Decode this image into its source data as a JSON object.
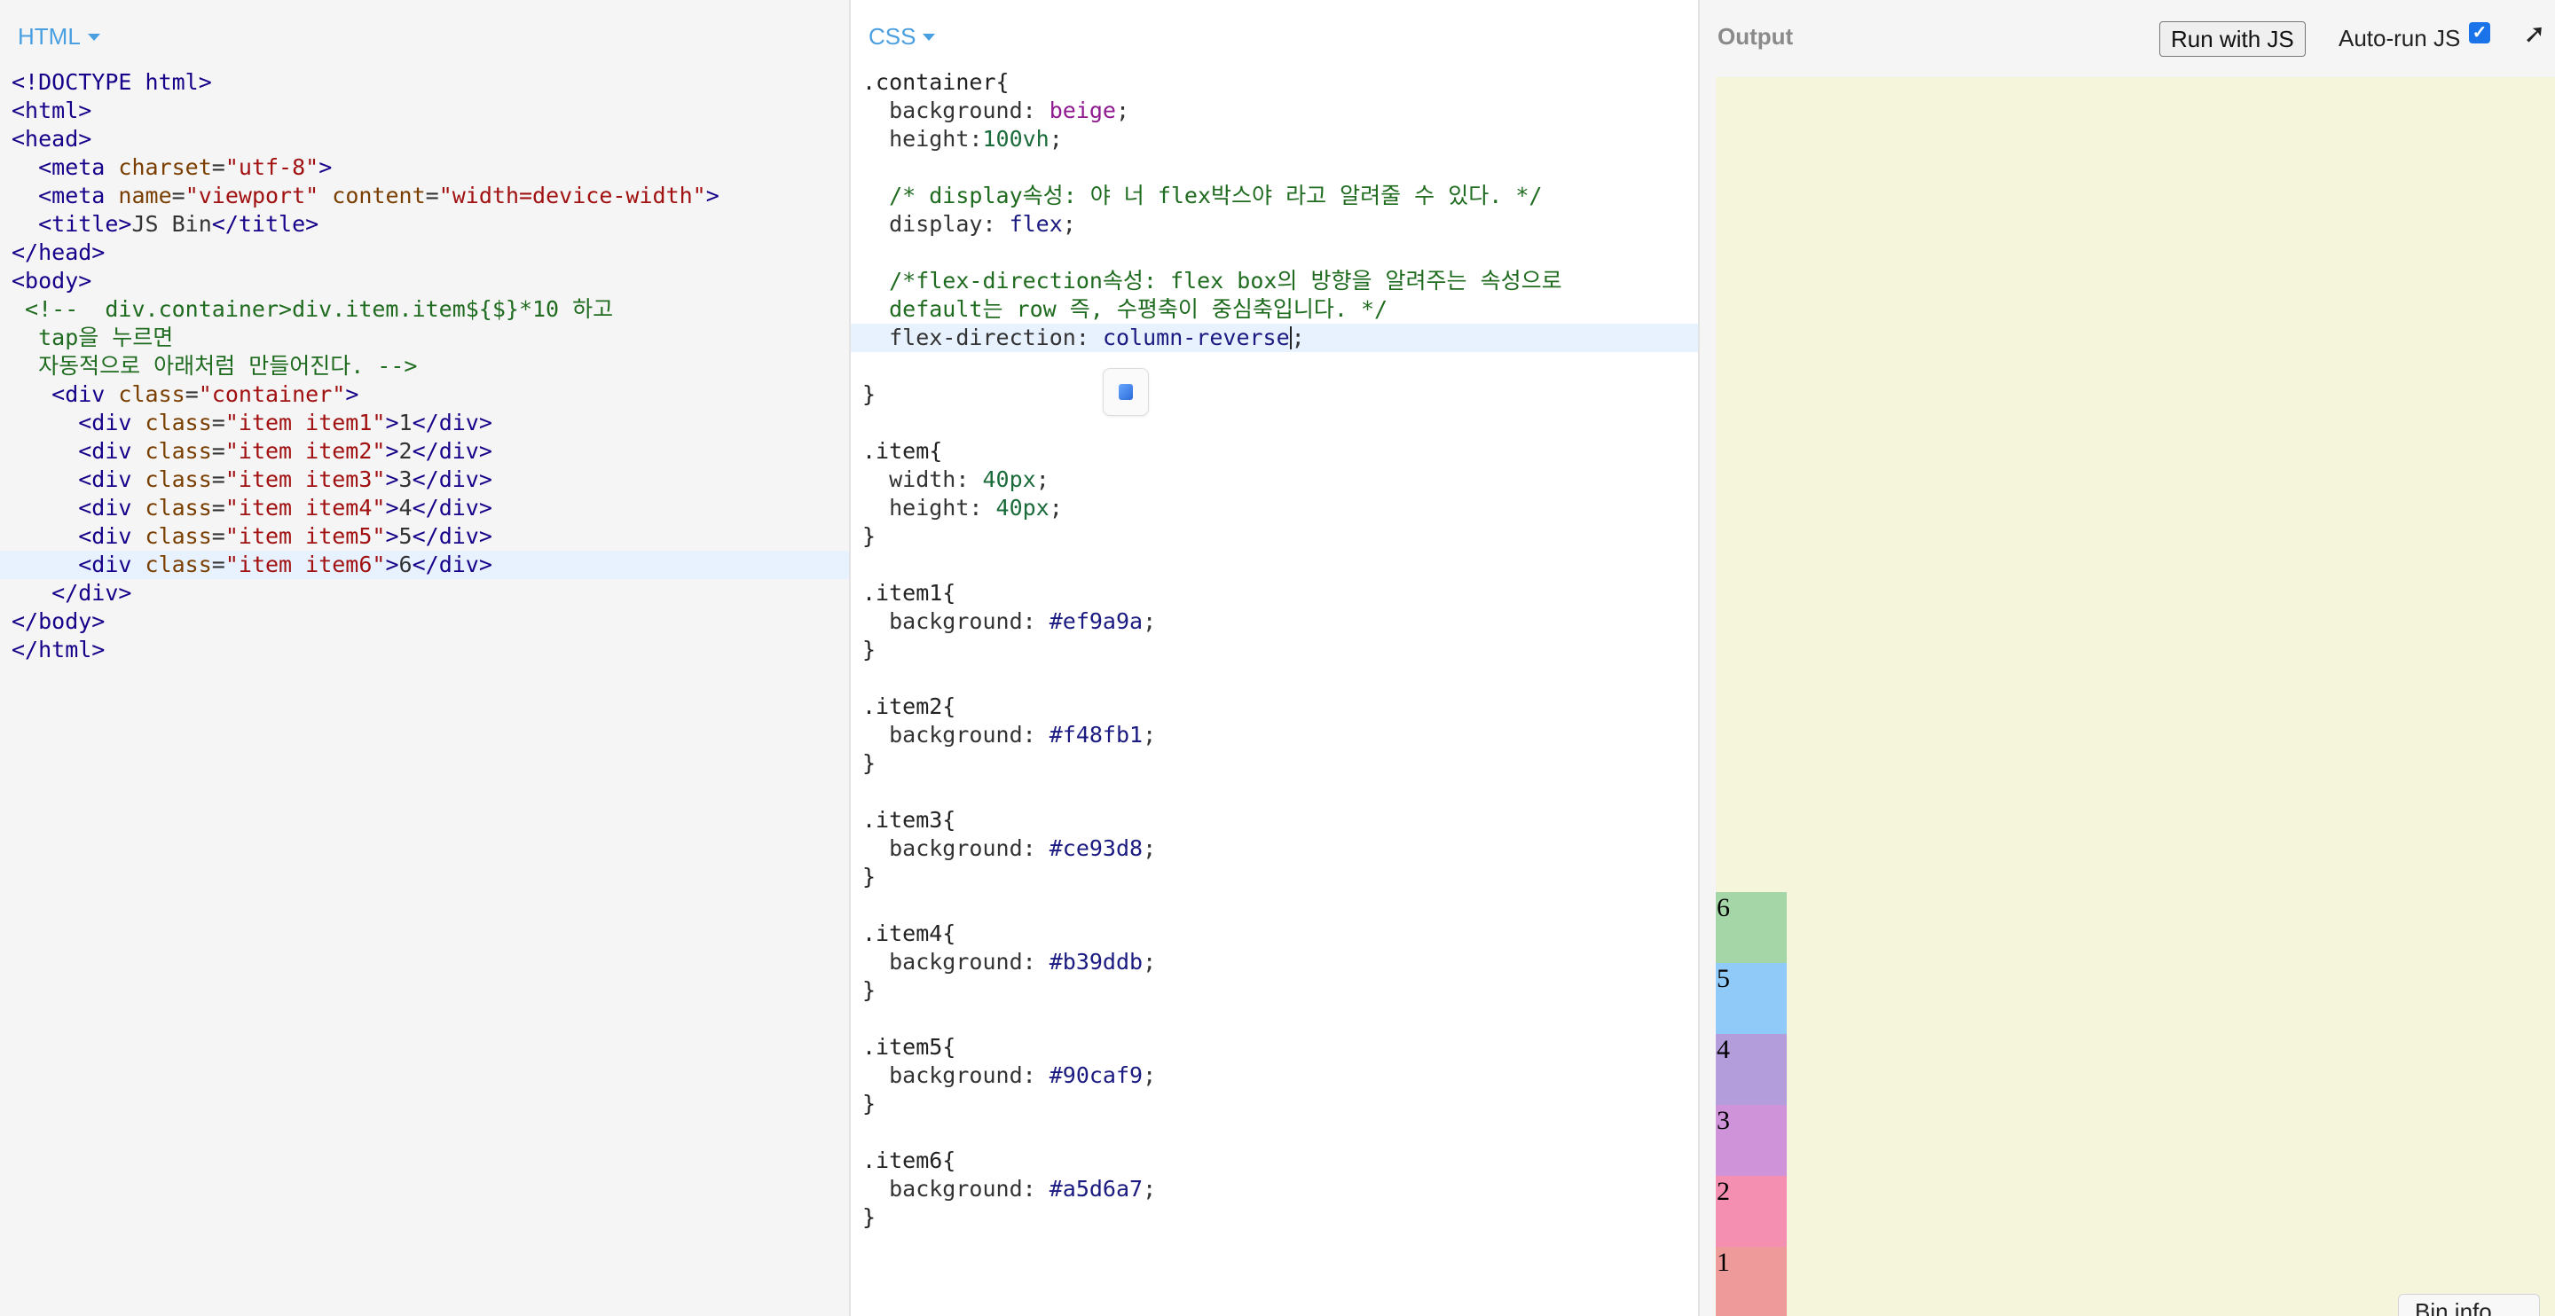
{
  "html_panel": {
    "tab_label": "HTML",
    "lines": [
      "<!DOCTYPE html>",
      "<html>",
      "<head>",
      "  <meta charset=\"utf-8\">",
      "  <meta name=\"viewport\" content=\"width=device-width\">",
      "  <title>JS Bin</title>",
      "</head>",
      "<body>",
      " <!--  div.container>div.item.item${$}*10 하고",
      "  tap을 누르면",
      "  자동적으로 아래처럼 만들어진다. -->",
      "   <div class=\"container\">",
      "     <div class=\"item item1\">1</div>",
      "     <div class=\"item item2\">2</div>",
      "     <div class=\"item item3\">3</div>",
      "     <div class=\"item item4\">4</div>",
      "     <div class=\"item item5\">5</div>",
      "     <div class=\"item item6\">6</div>",
      "   </div>",
      "</body>",
      "</html>"
    ]
  },
  "css_panel": {
    "tab_label": "CSS",
    "lines": [
      ".container{",
      "  background: beige;",
      "  height:100vh;",
      "",
      "  /* display속성: 야 너 flex박스야 라고 알려줄 수 있다. */",
      "  display: flex;",
      "",
      "  /*flex-direction속성: flex box의 방향을 알려주는 속성으로",
      "  default는 row 즉, 수평축이 중심축입니다. */",
      "  flex-direction: column-reverse;",
      "",
      "}",
      "",
      ".item{",
      "  width: 40px;",
      "  height: 40px;",
      "}",
      "",
      ".item1{",
      "  background: #ef9a9a;",
      "}",
      "",
      ".item2{",
      "  background: #f48fb1;",
      "}",
      "",
      ".item3{",
      "  background: #ce93d8;",
      "}",
      "",
      ".item4{",
      "  background: #b39ddb;",
      "}",
      "",
      ".item5{",
      "  background: #90caf9;",
      "}",
      "",
      ".item6{",
      "  background: #a5d6a7;",
      "}"
    ]
  },
  "output_panel": {
    "title": "Output",
    "run_button": "Run with JS",
    "autorun_label": "Auto-run JS",
    "autorun_checked": true,
    "expand_icon": "external-arrow-icon",
    "preview_background": "#f5f5dc",
    "items": [
      {
        "label": "1",
        "color": "#ef9a9a"
      },
      {
        "label": "2",
        "color": "#f48fb1"
      },
      {
        "label": "3",
        "color": "#ce93d8"
      },
      {
        "label": "4",
        "color": "#b39ddb"
      },
      {
        "label": "5",
        "color": "#90caf9"
      },
      {
        "label": "6",
        "color": "#a5d6a7"
      }
    ],
    "bin_info": "Bin info"
  },
  "colors": {
    "tab_accent": "#4a9fe0",
    "active_line": "#e8f2ff"
  }
}
